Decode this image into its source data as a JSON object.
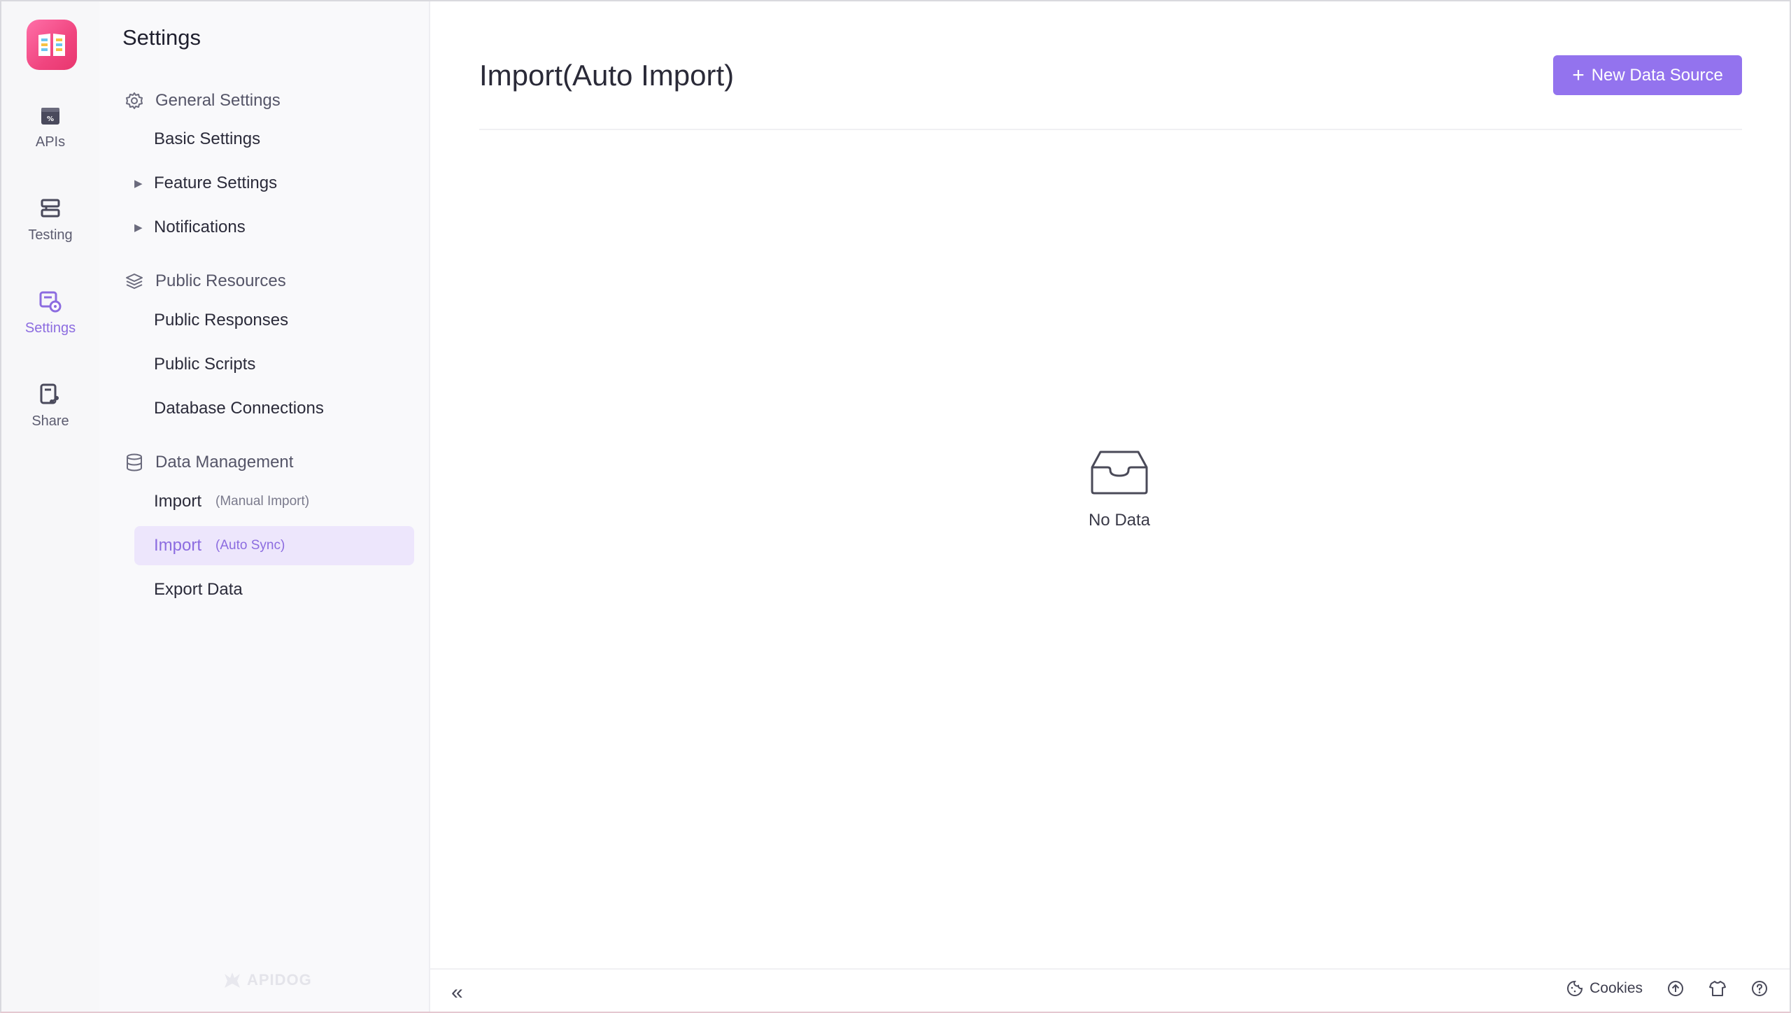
{
  "rail": {
    "items": [
      {
        "label": "APIs",
        "icon": "api-icon"
      },
      {
        "label": "Testing",
        "icon": "testing-icon"
      },
      {
        "label": "Settings",
        "icon": "settings-icon"
      },
      {
        "label": "Share",
        "icon": "share-icon"
      }
    ],
    "active": "Settings"
  },
  "sidebar": {
    "title": "Settings",
    "general": {
      "heading": "General Settings",
      "items": [
        "Basic Settings",
        "Feature Settings",
        "Notifications"
      ]
    },
    "public": {
      "heading": "Public Resources",
      "items": [
        "Public Responses",
        "Public Scripts",
        "Database Connections"
      ]
    },
    "data": {
      "heading": "Data Management",
      "import_manual": {
        "label": "Import",
        "sub": "(Manual Import)"
      },
      "import_auto": {
        "label": "Import",
        "sub": "(Auto Sync)"
      },
      "export": "Export Data"
    },
    "watermark": "APIDOG"
  },
  "main": {
    "title": "Import(Auto Import)",
    "new_button": "New Data Source",
    "empty_text": "No Data"
  },
  "footer": {
    "cookies": "Cookies"
  },
  "colors": {
    "accent": "#9373ee",
    "active_text": "#8c6ce0",
    "active_bg": "#ede6fc"
  }
}
